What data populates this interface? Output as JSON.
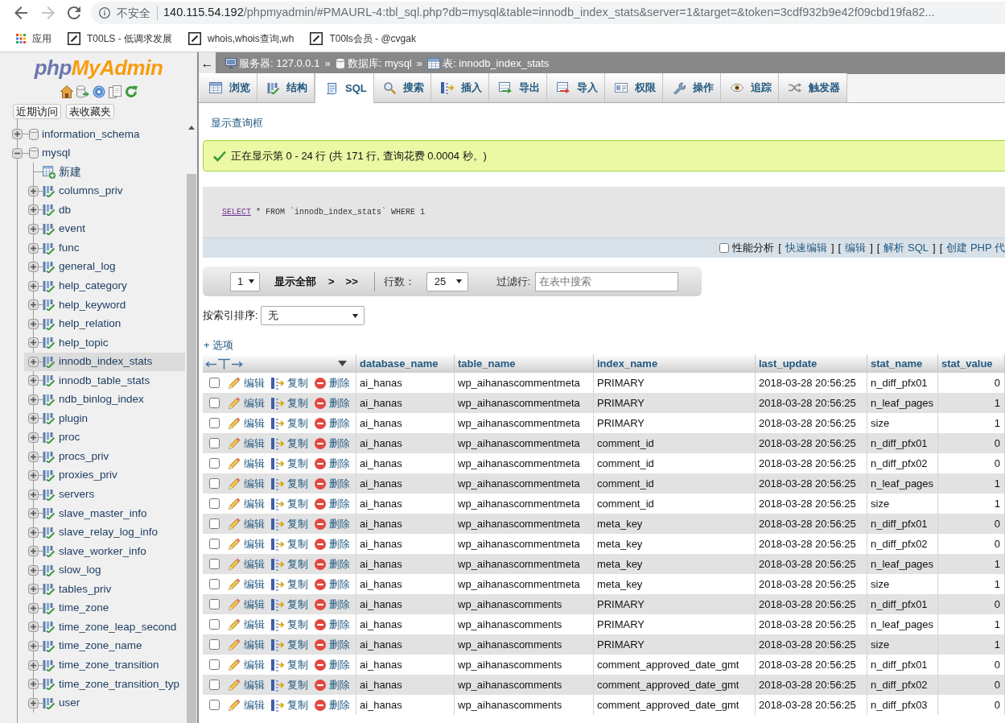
{
  "browser": {
    "security_label": "不安全",
    "url_host": "140.115.54.192",
    "url_path": "/phpmyadmin/#PMAURL-4:tbl_sql.php?db=mysql&table=innodb_index_stats&server=1&target=&token=3cdf932b9e42f09cbd19fa82...",
    "bookmarks": [
      {
        "kind": "apps",
        "label": "应用"
      },
      {
        "kind": "site",
        "label": "T00LS - 低调求发展"
      },
      {
        "kind": "site",
        "label": "whois,whois查询,wh"
      },
      {
        "kind": "site",
        "label": "T00ls会员 - @cvgak"
      }
    ]
  },
  "sidebar": {
    "logo": {
      "prefix": "php",
      "name": "MyAdmin"
    },
    "buttons": [
      "近期访问",
      "表收藏夹"
    ],
    "tree": [
      {
        "kind": "database",
        "label": "information_schema",
        "expanded": false
      },
      {
        "kind": "database",
        "label": "mysql",
        "expanded": true,
        "children": [
          {
            "kind": "new",
            "label": "新建",
            "selected": false
          },
          {
            "kind": "table",
            "label": "columns_priv",
            "expanded": false,
            "selected": false
          },
          {
            "kind": "table",
            "label": "db",
            "expanded": false,
            "selected": false
          },
          {
            "kind": "table",
            "label": "event",
            "expanded": false,
            "selected": false
          },
          {
            "kind": "table",
            "label": "func",
            "expanded": false,
            "selected": false
          },
          {
            "kind": "table",
            "label": "general_log",
            "expanded": false,
            "selected": false
          },
          {
            "kind": "table",
            "label": "help_category",
            "expanded": false,
            "selected": false
          },
          {
            "kind": "table",
            "label": "help_keyword",
            "expanded": false,
            "selected": false
          },
          {
            "kind": "table",
            "label": "help_relation",
            "expanded": false,
            "selected": false
          },
          {
            "kind": "table",
            "label": "help_topic",
            "expanded": false,
            "selected": false
          },
          {
            "kind": "table",
            "label": "innodb_index_stats",
            "expanded": false,
            "selected": true
          },
          {
            "kind": "table",
            "label": "innodb_table_stats",
            "expanded": false,
            "selected": false
          },
          {
            "kind": "table",
            "label": "ndb_binlog_index",
            "expanded": false,
            "selected": false
          },
          {
            "kind": "table",
            "label": "plugin",
            "expanded": false,
            "selected": false
          },
          {
            "kind": "table",
            "label": "proc",
            "expanded": false,
            "selected": false
          },
          {
            "kind": "table",
            "label": "procs_priv",
            "expanded": false,
            "selected": false
          },
          {
            "kind": "table",
            "label": "proxies_priv",
            "expanded": false,
            "selected": false
          },
          {
            "kind": "table",
            "label": "servers",
            "expanded": false,
            "selected": false
          },
          {
            "kind": "table",
            "label": "slave_master_info",
            "expanded": false,
            "selected": false
          },
          {
            "kind": "table",
            "label": "slave_relay_log_info",
            "expanded": false,
            "selected": false
          },
          {
            "kind": "table",
            "label": "slave_worker_info",
            "expanded": false,
            "selected": false
          },
          {
            "kind": "table",
            "label": "slow_log",
            "expanded": false,
            "selected": false
          },
          {
            "kind": "table",
            "label": "tables_priv",
            "expanded": false,
            "selected": false
          },
          {
            "kind": "table",
            "label": "time_zone",
            "expanded": false,
            "selected": false
          },
          {
            "kind": "table",
            "label": "time_zone_leap_second",
            "expanded": false,
            "selected": false
          },
          {
            "kind": "table",
            "label": "time_zone_name",
            "expanded": false,
            "selected": false
          },
          {
            "kind": "table",
            "label": "time_zone_transition",
            "expanded": false,
            "selected": false
          },
          {
            "kind": "table",
            "label": "time_zone_transition_typ",
            "expanded": false,
            "selected": false
          },
          {
            "kind": "table",
            "label": "user",
            "expanded": false,
            "selected": false
          }
        ]
      }
    ]
  },
  "main": {
    "collapse_button": "←",
    "breadcrumb": [
      {
        "kind": "server",
        "label": "服务器: 127.0.0.1"
      },
      {
        "kind": "database",
        "separator": "»",
        "label": "数据库: mysql"
      },
      {
        "kind": "table",
        "separator": "»",
        "label": "表: innodb_index_stats"
      }
    ],
    "tabs": [
      {
        "kind": "browse",
        "label": "浏览",
        "selected": false
      },
      {
        "kind": "structure",
        "label": "结构",
        "selected": false
      },
      {
        "kind": "sql",
        "label": "SQL",
        "selected": true
      },
      {
        "kind": "search",
        "label": "搜索",
        "selected": false
      },
      {
        "kind": "insert",
        "label": "插入",
        "selected": false
      },
      {
        "kind": "export",
        "label": "导出",
        "selected": false
      },
      {
        "kind": "import",
        "label": "导入",
        "selected": false
      },
      {
        "kind": "privileges",
        "label": "权限",
        "selected": false
      },
      {
        "kind": "operations",
        "label": "操作",
        "selected": false
      },
      {
        "kind": "tracking",
        "label": "追踪",
        "selected": false
      },
      {
        "kind": "triggers",
        "label": "触发器",
        "selected": false
      }
    ],
    "show_query_link": "显示查询框",
    "message": {
      "kind": "success",
      "text": "正在显示第 0 - 24 行 (共 171 行, 查询花费 0.0004 秒。)"
    },
    "sql_query": [
      {
        "kind": "link",
        "text": "SELECT"
      },
      {
        "kind": "plain",
        "text": "* FROM `innodb_index_stats` WHERE 1"
      }
    ],
    "query_actions": {
      "profiling": {
        "label": "性能分析",
        "checked": false
      },
      "links": [
        {
          "open": "[",
          "label": "快速编辑",
          "close": "]"
        },
        {
          "open": "[",
          "label": "编辑",
          "close": "]"
        },
        {
          "open": "[",
          "label": "解析 SQL",
          "close": "]"
        },
        {
          "open": "[",
          "label": "创建 PHP 代"
        }
      ]
    },
    "navigation": {
      "page": "1",
      "show_all": "显示全部",
      "next": ">",
      "last": ">>",
      "rows_label": "行数：",
      "rows": "25",
      "filter_label": "过滤行:",
      "filter_placeholder": "在表中搜索"
    },
    "sort": {
      "label": "按索引排序:",
      "value": "无"
    },
    "options_link": "+ 选项",
    "table": {
      "columns": [
        "database_name",
        "table_name",
        "index_name",
        "last_update",
        "stat_name",
        "stat_value"
      ],
      "rows": [
        {
          "checked": false,
          "actions": [
            {
              "kind": "edit",
              "label": "编辑"
            },
            {
              "kind": "copy",
              "label": "复制"
            },
            {
              "kind": "delete",
              "label": "删除"
            }
          ],
          "cells": [
            "ai_hanas",
            "wp_aihanascommentmeta",
            "PRIMARY",
            "2018-03-28 20:56:25",
            "n_diff_pfx01",
            "0"
          ]
        },
        {
          "checked": false,
          "actions": [
            {
              "kind": "edit",
              "label": "编辑"
            },
            {
              "kind": "copy",
              "label": "复制"
            },
            {
              "kind": "delete",
              "label": "删除"
            }
          ],
          "cells": [
            "ai_hanas",
            "wp_aihanascommentmeta",
            "PRIMARY",
            "2018-03-28 20:56:25",
            "n_leaf_pages",
            "1"
          ]
        },
        {
          "checked": false,
          "actions": [
            {
              "kind": "edit",
              "label": "编辑"
            },
            {
              "kind": "copy",
              "label": "复制"
            },
            {
              "kind": "delete",
              "label": "删除"
            }
          ],
          "cells": [
            "ai_hanas",
            "wp_aihanascommentmeta",
            "PRIMARY",
            "2018-03-28 20:56:25",
            "size",
            "1"
          ]
        },
        {
          "checked": false,
          "actions": [
            {
              "kind": "edit",
              "label": "编辑"
            },
            {
              "kind": "copy",
              "label": "复制"
            },
            {
              "kind": "delete",
              "label": "删除"
            }
          ],
          "cells": [
            "ai_hanas",
            "wp_aihanascommentmeta",
            "comment_id",
            "2018-03-28 20:56:25",
            "n_diff_pfx01",
            "0"
          ]
        },
        {
          "checked": false,
          "actions": [
            {
              "kind": "edit",
              "label": "编辑"
            },
            {
              "kind": "copy",
              "label": "复制"
            },
            {
              "kind": "delete",
              "label": "删除"
            }
          ],
          "cells": [
            "ai_hanas",
            "wp_aihanascommentmeta",
            "comment_id",
            "2018-03-28 20:56:25",
            "n_diff_pfx02",
            "0"
          ]
        },
        {
          "checked": false,
          "actions": [
            {
              "kind": "edit",
              "label": "编辑"
            },
            {
              "kind": "copy",
              "label": "复制"
            },
            {
              "kind": "delete",
              "label": "删除"
            }
          ],
          "cells": [
            "ai_hanas",
            "wp_aihanascommentmeta",
            "comment_id",
            "2018-03-28 20:56:25",
            "n_leaf_pages",
            "1"
          ]
        },
        {
          "checked": false,
          "actions": [
            {
              "kind": "edit",
              "label": "编辑"
            },
            {
              "kind": "copy",
              "label": "复制"
            },
            {
              "kind": "delete",
              "label": "删除"
            }
          ],
          "cells": [
            "ai_hanas",
            "wp_aihanascommentmeta",
            "comment_id",
            "2018-03-28 20:56:25",
            "size",
            "1"
          ]
        },
        {
          "checked": false,
          "actions": [
            {
              "kind": "edit",
              "label": "编辑"
            },
            {
              "kind": "copy",
              "label": "复制"
            },
            {
              "kind": "delete",
              "label": "删除"
            }
          ],
          "cells": [
            "ai_hanas",
            "wp_aihanascommentmeta",
            "meta_key",
            "2018-03-28 20:56:25",
            "n_diff_pfx01",
            "0"
          ]
        },
        {
          "checked": false,
          "actions": [
            {
              "kind": "edit",
              "label": "编辑"
            },
            {
              "kind": "copy",
              "label": "复制"
            },
            {
              "kind": "delete",
              "label": "删除"
            }
          ],
          "cells": [
            "ai_hanas",
            "wp_aihanascommentmeta",
            "meta_key",
            "2018-03-28 20:56:25",
            "n_diff_pfx02",
            "0"
          ]
        },
        {
          "checked": false,
          "actions": [
            {
              "kind": "edit",
              "label": "编辑"
            },
            {
              "kind": "copy",
              "label": "复制"
            },
            {
              "kind": "delete",
              "label": "删除"
            }
          ],
          "cells": [
            "ai_hanas",
            "wp_aihanascommentmeta",
            "meta_key",
            "2018-03-28 20:56:25",
            "n_leaf_pages",
            "1"
          ]
        },
        {
          "checked": false,
          "actions": [
            {
              "kind": "edit",
              "label": "编辑"
            },
            {
              "kind": "copy",
              "label": "复制"
            },
            {
              "kind": "delete",
              "label": "删除"
            }
          ],
          "cells": [
            "ai_hanas",
            "wp_aihanascommentmeta",
            "meta_key",
            "2018-03-28 20:56:25",
            "size",
            "1"
          ]
        },
        {
          "checked": false,
          "actions": [
            {
              "kind": "edit",
              "label": "编辑"
            },
            {
              "kind": "copy",
              "label": "复制"
            },
            {
              "kind": "delete",
              "label": "删除"
            }
          ],
          "cells": [
            "ai_hanas",
            "wp_aihanascomments",
            "PRIMARY",
            "2018-03-28 20:56:25",
            "n_diff_pfx01",
            "0"
          ]
        },
        {
          "checked": false,
          "actions": [
            {
              "kind": "edit",
              "label": "编辑"
            },
            {
              "kind": "copy",
              "label": "复制"
            },
            {
              "kind": "delete",
              "label": "删除"
            }
          ],
          "cells": [
            "ai_hanas",
            "wp_aihanascomments",
            "PRIMARY",
            "2018-03-28 20:56:25",
            "n_leaf_pages",
            "1"
          ]
        },
        {
          "checked": false,
          "actions": [
            {
              "kind": "edit",
              "label": "编辑"
            },
            {
              "kind": "copy",
              "label": "复制"
            },
            {
              "kind": "delete",
              "label": "删除"
            }
          ],
          "cells": [
            "ai_hanas",
            "wp_aihanascomments",
            "PRIMARY",
            "2018-03-28 20:56:25",
            "size",
            "1"
          ]
        },
        {
          "checked": false,
          "actions": [
            {
              "kind": "edit",
              "label": "编辑"
            },
            {
              "kind": "copy",
              "label": "复制"
            },
            {
              "kind": "delete",
              "label": "删除"
            }
          ],
          "cells": [
            "ai_hanas",
            "wp_aihanascomments",
            "comment_approved_date_gmt",
            "2018-03-28 20:56:25",
            "n_diff_pfx01",
            "0"
          ]
        },
        {
          "checked": false,
          "actions": [
            {
              "kind": "edit",
              "label": "编辑"
            },
            {
              "kind": "copy",
              "label": "复制"
            },
            {
              "kind": "delete",
              "label": "删除"
            }
          ],
          "cells": [
            "ai_hanas",
            "wp_aihanascomments",
            "comment_approved_date_gmt",
            "2018-03-28 20:56:25",
            "n_diff_pfx02",
            "0"
          ]
        },
        {
          "checked": false,
          "actions": [
            {
              "kind": "edit",
              "label": "编辑"
            },
            {
              "kind": "copy",
              "label": "复制"
            },
            {
              "kind": "delete",
              "label": "删除"
            }
          ],
          "cells": [
            "ai_hanas",
            "wp_aihanascomments",
            "comment_approved_date_gmt",
            "2018-03-28 20:56:25",
            "n_diff_pfx03",
            "0"
          ]
        }
      ]
    }
  }
}
